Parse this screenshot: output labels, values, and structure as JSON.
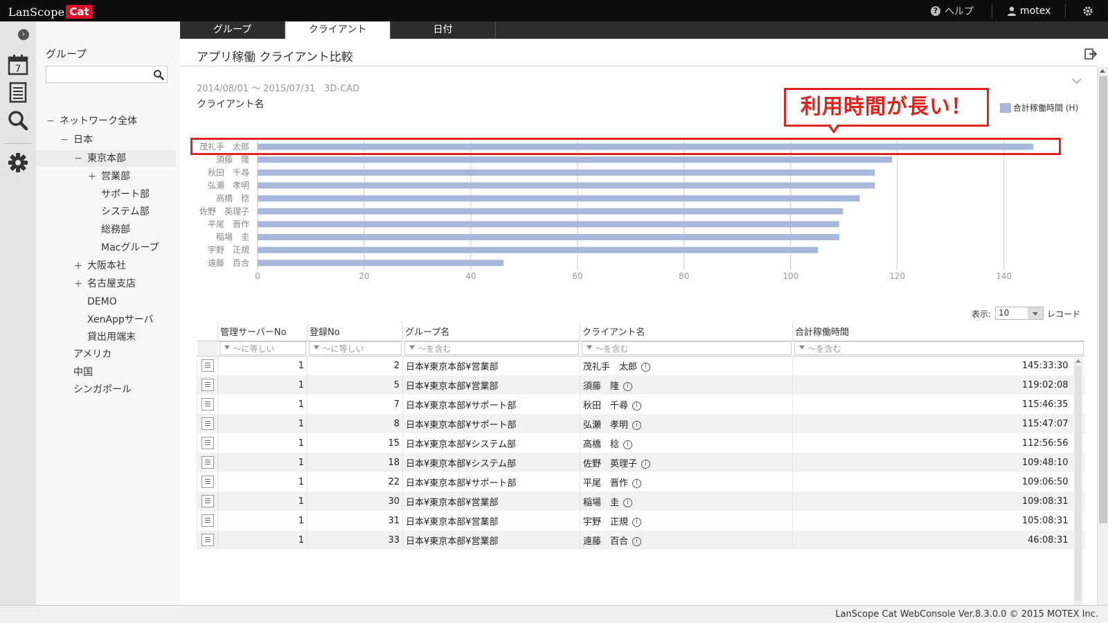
{
  "app": {
    "logo_text": "LanScope",
    "logo_badge": "Cat",
    "help_label": "ヘルプ",
    "user_label": "motex"
  },
  "tree": {
    "title": "グループ",
    "search_placeholder": "",
    "nodes": [
      {
        "label": "ネットワーク全体",
        "toggle": "−",
        "indent": 0,
        "selected": false
      },
      {
        "label": "日本",
        "toggle": "−",
        "indent": 1,
        "selected": false
      },
      {
        "label": "東京本部",
        "toggle": "−",
        "indent": 2,
        "selected": true
      },
      {
        "label": "営業部",
        "toggle": "+",
        "indent": 3,
        "selected": false
      },
      {
        "label": "サポート部",
        "toggle": "",
        "indent": 3,
        "selected": false
      },
      {
        "label": "システム部",
        "toggle": "",
        "indent": 3,
        "selected": false
      },
      {
        "label": "総務部",
        "toggle": "",
        "indent": 3,
        "selected": false
      },
      {
        "label": "Macグループ",
        "toggle": "",
        "indent": 3,
        "selected": false
      },
      {
        "label": "大阪本社",
        "toggle": "+",
        "indent": 2,
        "selected": false
      },
      {
        "label": "名古屋支店",
        "toggle": "+",
        "indent": 2,
        "selected": false
      },
      {
        "label": "DEMO",
        "toggle": "",
        "indent": 2,
        "selected": false
      },
      {
        "label": "XenAppサーバ",
        "toggle": "",
        "indent": 2,
        "selected": false
      },
      {
        "label": "貸出用端末",
        "toggle": "",
        "indent": 2,
        "selected": false
      },
      {
        "label": "アメリカ",
        "toggle": "",
        "indent": 1,
        "selected": false
      },
      {
        "label": "中国",
        "toggle": "",
        "indent": 1,
        "selected": false
      },
      {
        "label": "シンガポール",
        "toggle": "",
        "indent": 1,
        "selected": false
      }
    ]
  },
  "tabs": [
    {
      "label": "グループ",
      "active": false
    },
    {
      "label": "クライアント",
      "active": true
    },
    {
      "label": "日付",
      "active": false
    }
  ],
  "page": {
    "title": "アプリ稼働 クライアント比較",
    "meta": "2014/08/01 ～ 2015/07/31　3D-CAD",
    "y_title": "クライアント名",
    "callout": "利用時間が長い！"
  },
  "chart_data": {
    "type": "bar",
    "orientation": "horizontal",
    "categories": [
      "茂礼手　太郎",
      "須藤　隆",
      "秋田　千尋",
      "弘瀬　孝明",
      "高橋　稔",
      "佐野　英理子",
      "平尾　晋作",
      "稲場　圭",
      "宇野　正規",
      "遠藤　百合"
    ],
    "series": [
      {
        "name": "合計稼働時間 (H)",
        "color": "#a8b8dc",
        "values": [
          145.56,
          119.03,
          115.78,
          115.79,
          112.95,
          109.8,
          109.11,
          109.14,
          105.14,
          46.14
        ]
      }
    ],
    "xlim": [
      0,
      148
    ],
    "xticks": [
      0,
      20,
      40,
      60,
      80,
      100,
      120,
      140
    ],
    "grid": true,
    "legend": "top-right",
    "highlight_category": "茂礼手　太郎"
  },
  "table": {
    "display_label": "表示:",
    "display_value": "10",
    "record_label": "レコード",
    "columns": [
      "管理サーバーNo",
      "登録No",
      "グループ名",
      "クライアント名",
      "合計稼働時間"
    ],
    "filters": [
      "～に等しい",
      "～に等しい",
      "～を含む",
      "～を含む",
      "～を含む"
    ],
    "rows": [
      {
        "server": "1",
        "reg": "2",
        "group": "日本¥東京本部¥営業部",
        "client": "茂礼手　太郎",
        "time": "145:33:30"
      },
      {
        "server": "1",
        "reg": "5",
        "group": "日本¥東京本部¥営業部",
        "client": "須藤　隆",
        "time": "119:02:08"
      },
      {
        "server": "1",
        "reg": "7",
        "group": "日本¥東京本部¥サポート部",
        "client": "秋田　千尋",
        "time": "115:46:35"
      },
      {
        "server": "1",
        "reg": "8",
        "group": "日本¥東京本部¥サポート部",
        "client": "弘瀬　孝明",
        "time": "115:47:07"
      },
      {
        "server": "1",
        "reg": "15",
        "group": "日本¥東京本部¥システム部",
        "client": "高橋　稔",
        "time": "112:56:56"
      },
      {
        "server": "1",
        "reg": "18",
        "group": "日本¥東京本部¥システム部",
        "client": "佐野　英理子",
        "time": "109:48:10"
      },
      {
        "server": "1",
        "reg": "22",
        "group": "日本¥東京本部¥サポート部",
        "client": "平尾　晋作",
        "time": "109:06:50"
      },
      {
        "server": "1",
        "reg": "30",
        "group": "日本¥東京本部¥営業部",
        "client": "稲場　圭",
        "time": "109:08:31"
      },
      {
        "server": "1",
        "reg": "31",
        "group": "日本¥東京本部¥営業部",
        "client": "宇野　正規",
        "time": "105:08:31"
      },
      {
        "server": "1",
        "reg": "33",
        "group": "日本¥東京本部¥営業部",
        "client": "遠藤　百合",
        "time": "46:08:31"
      }
    ]
  },
  "footer": {
    "text": "LanScope Cat WebConsole Ver.8.3.0.0 © 2015 MOTEX Inc."
  }
}
